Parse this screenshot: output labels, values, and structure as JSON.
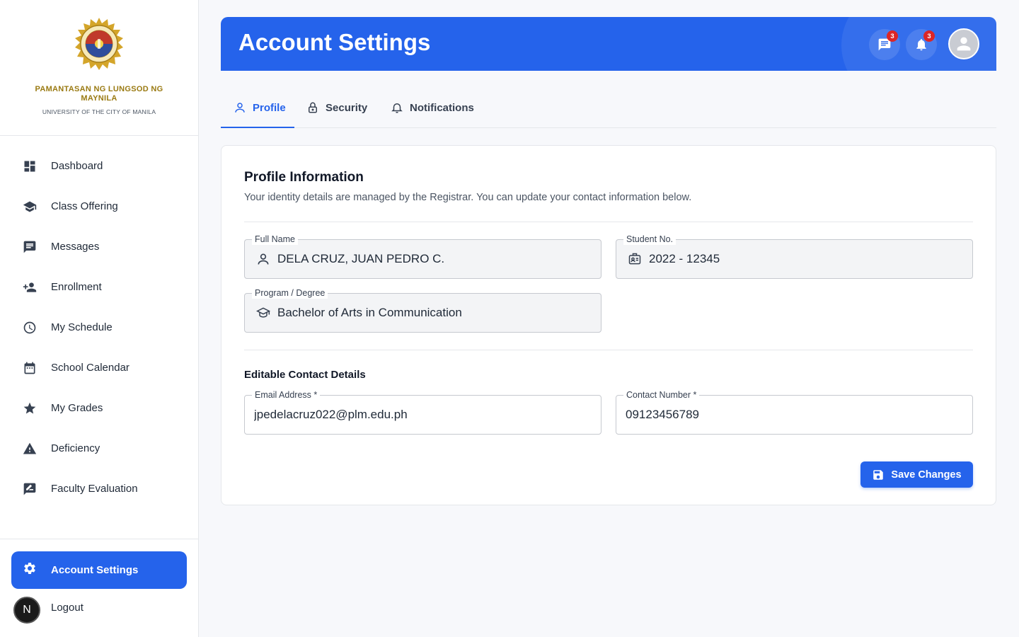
{
  "brand": {
    "name": "PAMANTASAN NG LUNGSOD NG MAYNILA",
    "subtitle": "UNIVERSITY OF THE CITY OF MANILA"
  },
  "sidebar": {
    "items": [
      {
        "label": "Dashboard",
        "icon": "dashboard-icon"
      },
      {
        "label": "Class Offering",
        "icon": "graduation-cap-icon"
      },
      {
        "label": "Messages",
        "icon": "message-icon"
      },
      {
        "label": "Enrollment",
        "icon": "person-add-icon"
      },
      {
        "label": "My Schedule",
        "icon": "clock-icon"
      },
      {
        "label": "School Calendar",
        "icon": "calendar-icon"
      },
      {
        "label": "My Grades",
        "icon": "star-icon"
      },
      {
        "label": "Deficiency",
        "icon": "warning-icon"
      },
      {
        "label": "Faculty Evaluation",
        "icon": "rate-review-icon"
      }
    ],
    "active": {
      "label": "Account Settings",
      "icon": "gear-icon"
    },
    "logout": {
      "label": "Logout"
    },
    "dev_badge": "N"
  },
  "header": {
    "title": "Account Settings",
    "messages_count": "3",
    "notifications_count": "3"
  },
  "tabs": [
    {
      "label": "Profile",
      "icon": "user-icon",
      "active": true
    },
    {
      "label": "Security",
      "icon": "lock-icon",
      "active": false
    },
    {
      "label": "Notifications",
      "icon": "bell-icon",
      "active": false
    }
  ],
  "profile": {
    "title": "Profile Information",
    "description": "Your identity details are managed by the Registrar. You can update your contact information below.",
    "full_name": {
      "label": "Full Name",
      "value": "DELA CRUZ, JUAN PEDRO C."
    },
    "student_no": {
      "label": "Student No.",
      "value": "2022 - 12345"
    },
    "program": {
      "label": "Program / Degree",
      "value": "Bachelor of Arts in Communication"
    }
  },
  "contact": {
    "title": "Editable Contact Details",
    "email": {
      "label": "Email Address *",
      "value": "jpedelacruz022@plm.edu.ph"
    },
    "phone": {
      "label": "Contact Number *",
      "value": "09123456789"
    }
  },
  "save_button": {
    "label": "Save Changes"
  },
  "colors": {
    "accent": "#2563eb",
    "brand_gold": "#9a7a12",
    "badge_red": "#dc2626"
  }
}
